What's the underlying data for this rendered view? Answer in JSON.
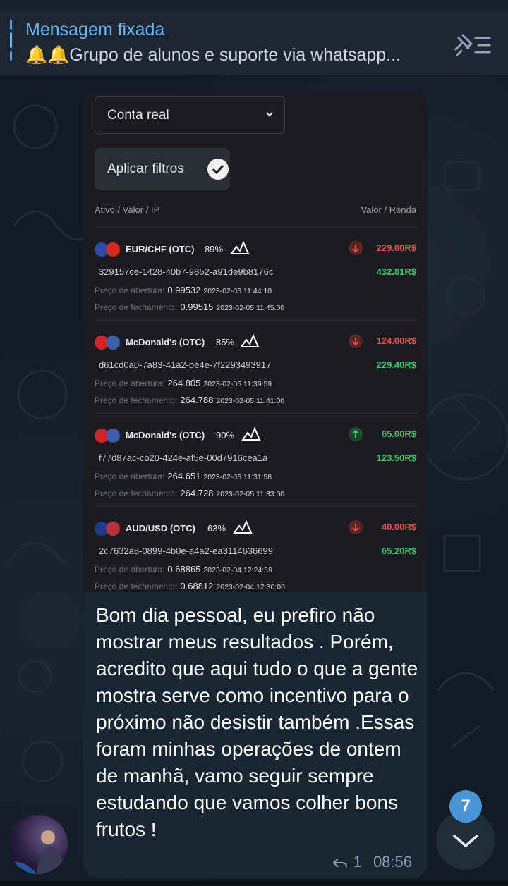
{
  "pinned": {
    "title": "Mensagem fixada",
    "text": "🔔🔔Grupo de alunos e suporte via whatsapp..."
  },
  "shot": {
    "account_select": "Conta real",
    "apply_button": "Aplicar filtros",
    "col_left": "Ativo / Valor / IP",
    "col_right": "Valor / Renda",
    "open_label": "Preço de abertura:",
    "close_label": "Preço de fechamento:",
    "trades": [
      {
        "asset": "EUR/CHF (OTC)",
        "pct": "89%",
        "direction": "down",
        "amount": "229.00R$",
        "profit": "432.81R$",
        "id": "329157ce-1428-40b7-9852-a91de9b8176c",
        "open_price": "0.99532",
        "open_time": "2023-02-05 11:44:10",
        "close_price": "0.99515",
        "close_time": "2023-02-05 11:45:00"
      },
      {
        "asset": "McDonald's (OTC)",
        "pct": "85%",
        "direction": "down",
        "amount": "124.00R$",
        "profit": "229.40R$",
        "id": "d61cd0a0-7a83-41a2-be4e-7f2293493917",
        "open_price": "264.805",
        "open_time": "2023-02-05 11:39:59",
        "close_price": "264.788",
        "close_time": "2023-02-05 11:41:00"
      },
      {
        "asset": "McDonald's (OTC)",
        "pct": "90%",
        "direction": "up",
        "amount": "65.00R$",
        "profit": "123.50R$",
        "id": "f77d87ac-cb20-424e-af5e-00d7916cea1a",
        "open_price": "264.651",
        "open_time": "2023-02-05 11:31:58",
        "close_price": "264.728",
        "close_time": "2023-02-05 11:33:00"
      },
      {
        "asset": "AUD/USD (OTC)",
        "pct": "63%",
        "direction": "down",
        "amount": "40.00R$",
        "profit": "65.20R$",
        "id": "2c7632a8-0899-4b0e-a4a2-ea3114636699",
        "open_price": "0.68865",
        "open_time": "2023-02-04 12:24:59",
        "close_price": "0.68812",
        "close_time": "2023-02-04 12:30:00"
      }
    ]
  },
  "message": {
    "text": "Bom dia pessoal, eu prefiro não mostrar meus resultados . Porém, acredito que aqui tudo o que a gente mostra serve como incentivo para o próximo não desistir também .Essas foram minhas operações de ontem de manhã, vamo seguir sempre estudando que vamos colher bons frutos !",
    "replies": "1",
    "time": "08:56"
  },
  "unread_count": "7",
  "colors": {
    "accent": "#6ab3f3",
    "loss": "#e4554f",
    "gain": "#3ec46d",
    "bubble": "#182533"
  }
}
